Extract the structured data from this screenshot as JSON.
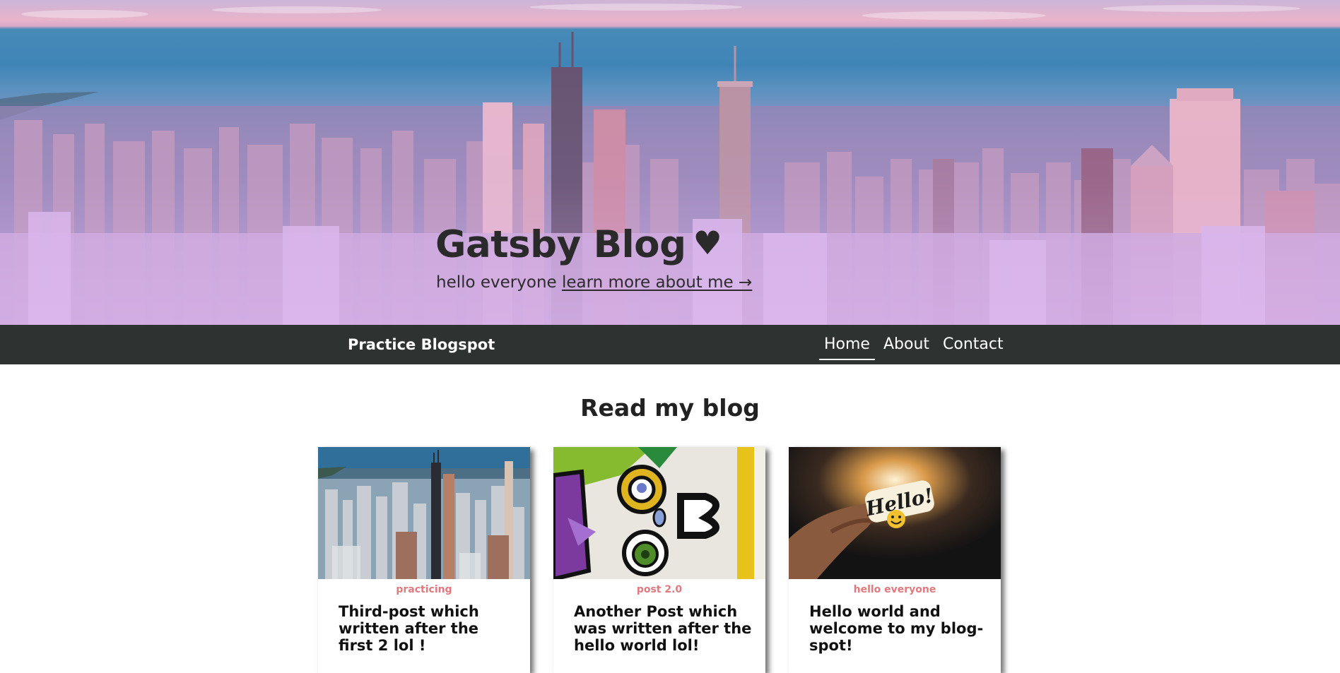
{
  "hero": {
    "title": "Gatsby Blog",
    "heart_icon": "heart-icon",
    "subtitle": "hello everyone",
    "link_text": "learn more about me →"
  },
  "navbar": {
    "brand": "Practice Blogspot",
    "links": [
      {
        "label": "Home",
        "active": true
      },
      {
        "label": "About",
        "active": false
      },
      {
        "label": "Contact",
        "active": false
      }
    ]
  },
  "main": {
    "heading": "Read my blog",
    "posts": [
      {
        "tag": "practicing",
        "title": "Third-post which written after the first 2 lol !",
        "image": "city-skyline-photo"
      },
      {
        "tag": "post 2.0",
        "title": "Another Post which was written after the hello world lol!",
        "image": "graffiti-photo"
      },
      {
        "tag": "hello everyone",
        "title": "Hello world and welcome to my blog-spot!",
        "image": "hello-sticker-photo"
      }
    ]
  },
  "colors": {
    "navbar_bg": "#2e3331",
    "tag_color": "#e07a7f"
  }
}
